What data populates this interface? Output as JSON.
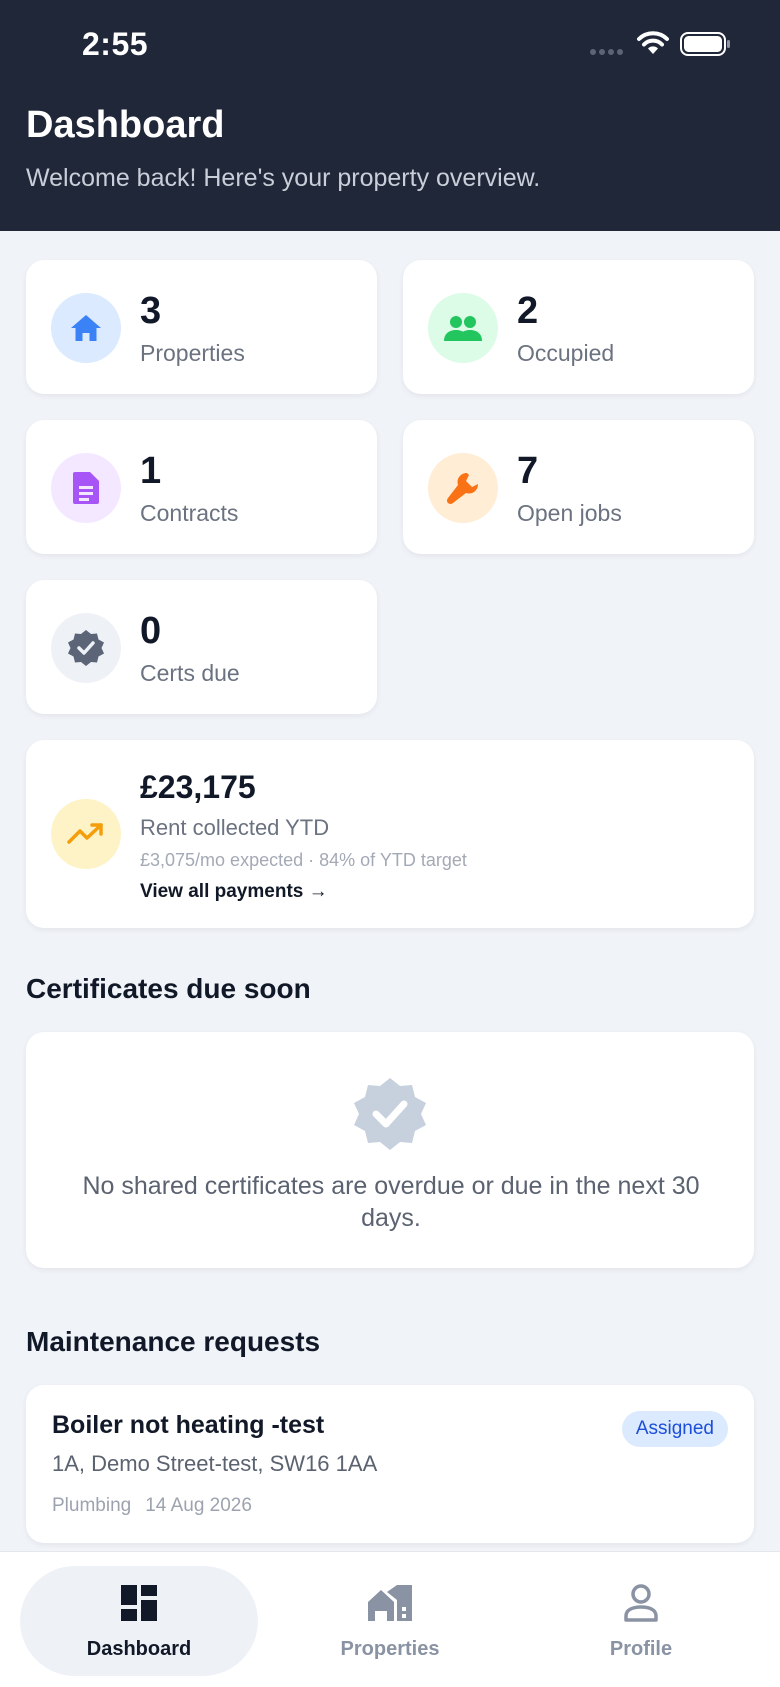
{
  "status": {
    "time": "2:55"
  },
  "header": {
    "title": "Dashboard",
    "subtitle": "Welcome back! Here's your property overview."
  },
  "stats": [
    {
      "value": "3",
      "label": "Properties",
      "icon": "home-icon",
      "bg": "#dbeafe",
      "fg": "#3b82f6"
    },
    {
      "value": "2",
      "label": "Occupied",
      "icon": "people-icon",
      "bg": "#dcfce7",
      "fg": "#22c55e"
    },
    {
      "value": "1",
      "label": "Contracts",
      "icon": "document-icon",
      "bg": "#f3e8ff",
      "fg": "#a855f7"
    },
    {
      "value": "7",
      "label": "Open jobs",
      "icon": "wrench-icon",
      "bg": "#ffedd5",
      "fg": "#f97316"
    },
    {
      "value": "0",
      "label": "Certs due",
      "icon": "verified-badge-icon",
      "bg": "#eef2f6",
      "fg": "#6b7280"
    }
  ],
  "rent": {
    "value": "£23,175",
    "label": "Rent collected YTD",
    "note": "£3,075/mo expected · 84% of YTD target",
    "link": "View all payments →",
    "icon": "trending-up-icon"
  },
  "certificates": {
    "title": "Certificates due soon",
    "empty_text": "No shared certificates are overdue or due in the next 30 days."
  },
  "maintenance": {
    "title": "Maintenance requests",
    "items": [
      {
        "title": "Boiler not heating -test",
        "address": "1A, Demo Street-test, SW16 1AA",
        "category": "Plumbing",
        "date": "14 Aug 2026",
        "status": "Assigned"
      }
    ]
  },
  "tabs": [
    {
      "label": "Dashboard",
      "icon": "dashboard-icon",
      "active": true
    },
    {
      "label": "Properties",
      "icon": "properties-icon",
      "active": false
    },
    {
      "label": "Profile",
      "icon": "profile-icon",
      "active": false
    }
  ],
  "colors": {
    "header_bg": "#1f2739",
    "page_bg": "#f0f3f8",
    "active_tab": "#111827",
    "inactive_tab": "#8a93a3"
  }
}
